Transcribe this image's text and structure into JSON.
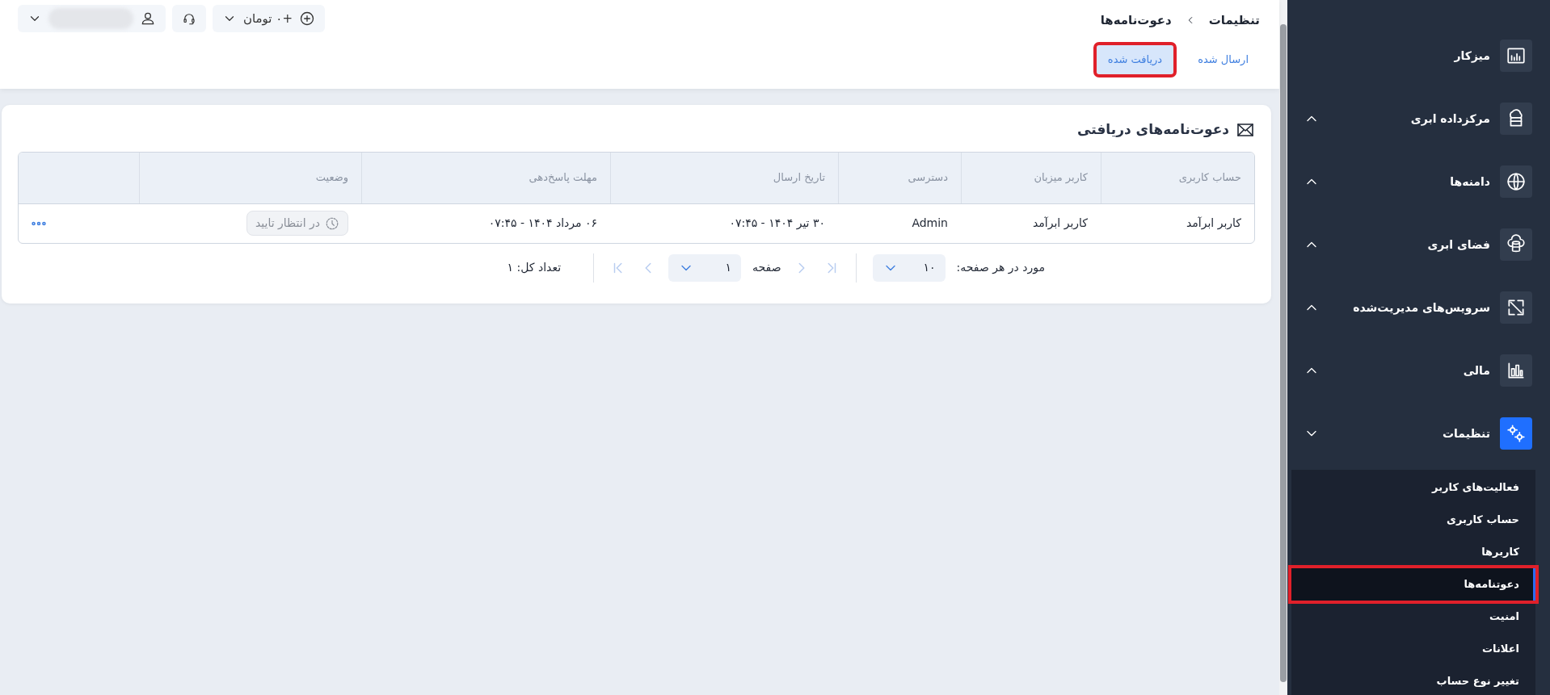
{
  "topbar": {
    "balance": "+۰ تومان"
  },
  "breadcrumb": [
    "تنظیمات",
    "دعوت‌نامه‌ها"
  ],
  "tabs": [
    {
      "label": "ارسال شده",
      "selected": false,
      "highlighted": false
    },
    {
      "label": "دریافت شده",
      "selected": true,
      "highlighted": true
    }
  ],
  "card": {
    "title": "دعوت‌نامه‌های دریافتی",
    "columns": [
      "حساب کاربری",
      "کاربر میزبان",
      "دسترسی",
      "تاریخ ارسال",
      "مهلت پاسخ‌دهی",
      "وضعیت"
    ],
    "rows": [
      {
        "cells": [
          "کاربر ابرآمد",
          "کاربر ابرآمد",
          "Admin",
          "۳۰ تیر ۱۴۰۴ - ۰۷:۴۵",
          "۰۶ مرداد ۱۴۰۴ - ۰۷:۴۵"
        ],
        "status": "در انتظار تایید"
      }
    ],
    "pagination": {
      "per_page_label": "مورد در هر صفحه:",
      "per_page": "۱۰",
      "page_label": "صفحه",
      "page": "۱",
      "total": "تعداد کل: ۱"
    }
  },
  "sidebar": {
    "items": [
      {
        "label": "میزکار",
        "kind": "dashboard",
        "selected": false
      },
      {
        "label": "مرکزداده ابری",
        "kind": "datacenter",
        "expanded": false,
        "selected": false
      },
      {
        "label": "دامنه‌ها",
        "kind": "globe",
        "expanded": false,
        "selected": false
      },
      {
        "label": "فضای ابری",
        "kind": "storage",
        "expanded": false,
        "selected": false
      },
      {
        "label": "سرویس‌های مدیریت‌شده",
        "kind": "managed",
        "expanded": false,
        "selected": false
      },
      {
        "label": "مالی",
        "kind": "finance",
        "expanded": false,
        "selected": false
      },
      {
        "label": "تنظیمات",
        "kind": "settings",
        "expanded": true,
        "selected": true,
        "children": [
          {
            "label": "فعالیت‌های کاربر",
            "selected": false,
            "highlighted": false
          },
          {
            "label": "حساب کاربری",
            "selected": false,
            "highlighted": false
          },
          {
            "label": "کاربرها",
            "selected": false,
            "highlighted": false
          },
          {
            "label": "دعوتنامه‌ها",
            "selected": true,
            "highlighted": true
          },
          {
            "label": "امنیت",
            "selected": false,
            "highlighted": false
          },
          {
            "label": "اعلانات",
            "selected": false,
            "highlighted": false
          },
          {
            "label": "تغییر نوع حساب",
            "selected": false,
            "highlighted": false
          }
        ]
      }
    ]
  }
}
